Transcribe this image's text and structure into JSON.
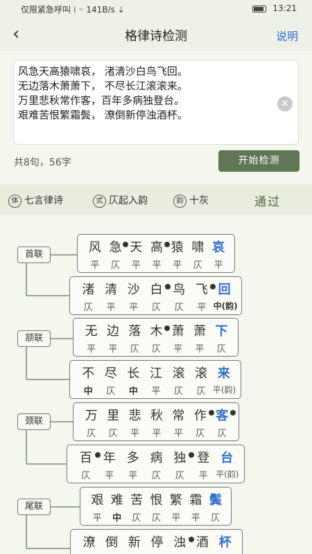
{
  "status": {
    "left": "仅限紧急呼叫 ⁞ ◦ 141B/s ⇣",
    "time": "13:21"
  },
  "nav": {
    "back": "‹",
    "title": "格律诗检测",
    "help": "说明"
  },
  "input": {
    "lines": [
      "风急天高猿啸哀，  渚清沙白鸟飞回。",
      "无边落木萧萧下，  不尽长江滚滚来。",
      "万里悲秋常作客，百年多病独登台。",
      "艰难苦恨繁霜鬓，  潦倒新停浊酒杯。"
    ],
    "clear": "✕"
  },
  "summary": {
    "count": "共8句，56字",
    "start": "开始检测"
  },
  "result": {
    "tags": [
      {
        "icon": "体",
        "text": "七言律诗"
      },
      {
        "icon": "式",
        "text": "仄起入韵"
      },
      {
        "icon": "韵",
        "text": "十灰"
      }
    ],
    "status": "通过"
  },
  "couplets": [
    {
      "name": "首联",
      "verses": [
        {
          "chars": [
            "风",
            "急",
            "天",
            "高",
            "猿",
            "啸",
            "哀"
          ],
          "tones": [
            "平",
            "仄",
            "平",
            "平",
            "平",
            "仄",
            "平"
          ]
        },
        {
          "chars": [
            "渚",
            "清",
            "沙",
            "白",
            "鸟",
            "飞",
            "回"
          ],
          "tones": [
            "仄",
            "平",
            "平",
            "仄",
            "仄",
            "平",
            "中(韵)"
          ]
        }
      ]
    },
    {
      "name": "颔联",
      "verses": [
        {
          "chars": [
            "无",
            "边",
            "落",
            "木",
            "萧",
            "萧",
            "下"
          ],
          "tones": [
            "平",
            "平",
            "仄",
            "仄",
            "平",
            "平",
            "仄"
          ]
        },
        {
          "chars": [
            "不",
            "尽",
            "长",
            "江",
            "滚",
            "滚",
            "来"
          ],
          "tones": [
            "中",
            "仄",
            "中",
            "平",
            "仄",
            "仄",
            "平(韵)"
          ]
        }
      ]
    },
    {
      "name": "颈联",
      "verses": [
        {
          "chars": [
            "万",
            "里",
            "悲",
            "秋",
            "常",
            "作",
            "客"
          ],
          "tones": [
            "仄",
            "仄",
            "平",
            "平",
            "平",
            "仄",
            "仄"
          ]
        },
        {
          "chars": [
            "百",
            "年",
            "多",
            "病",
            "独",
            "登",
            "台"
          ],
          "tones": [
            "仄",
            "平",
            "平",
            "仄",
            "仄",
            "平",
            "平(韵)"
          ]
        }
      ]
    },
    {
      "name": "尾联",
      "verses": [
        {
          "chars": [
            "艰",
            "难",
            "苦",
            "恨",
            "繁",
            "霜",
            "鬓"
          ],
          "tones": [
            "平",
            "中",
            "仄",
            "仄",
            "平",
            "平",
            "仄"
          ]
        },
        {
          "chars": [
            "潦",
            "倒",
            "新",
            "停",
            "浊",
            "酒",
            "杯"
          ],
          "tones": [
            "",
            "",
            "",
            "",
            "",
            "",
            ""
          ]
        }
      ]
    }
  ],
  "colors": {
    "accent": "#5f7755",
    "rhyme": "#2f6fd0",
    "background": "#f4f7ee"
  }
}
